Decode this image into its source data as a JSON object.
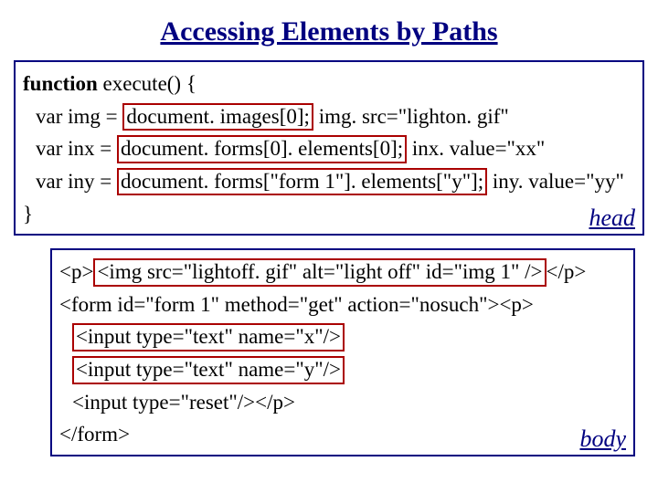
{
  "title": "Accessing Elements by Paths",
  "head": {
    "label": "head",
    "l1_a": "function",
    "l1_b": "  execute() {",
    "l2_a": "var img = ",
    "l2_b": "document. images[0];",
    "l2_c": " img. src=\"lighton. gif\"",
    "l3_a": "var inx = ",
    "l3_b": "document. forms[0]. elements[0];",
    "l3_c": " inx. value=\"xx\"",
    "l4_a": "var iny = ",
    "l4_b": "document. forms[\"form 1\"]. elements[\"y\"];",
    "l4_c": " iny. value=\"yy\"",
    "l5": "}"
  },
  "body": {
    "label": "body",
    "l1_a": "<p>",
    "l1_b": "<img src=\"lightoff. gif\" alt=\"light off\" id=\"img 1\" />",
    "l1_c": "</p>",
    "l2": "<form id=\"form 1\" method=\"get\" action=\"nosuch\"><p>",
    "l3": "<input type=\"text\" name=\"x\"/>",
    "l4": "<input type=\"text\" name=\"y\"/>",
    "l5": "<input type=\"reset\"/></p>",
    "l6": "</form>"
  }
}
